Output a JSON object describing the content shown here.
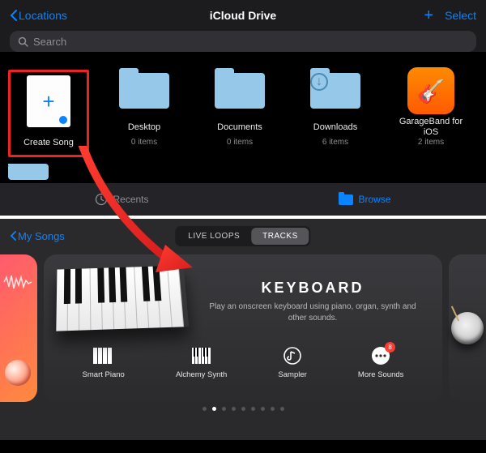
{
  "top": {
    "back_label": "Locations",
    "title": "iCloud Drive",
    "select_label": "Select",
    "search_placeholder": "Search",
    "items": [
      {
        "label": "Create Song",
        "sub": ""
      },
      {
        "label": "Desktop",
        "sub": "0 items",
        "glyph": ""
      },
      {
        "label": "Documents",
        "sub": "0 items",
        "glyph": ""
      },
      {
        "label": "Downloads",
        "sub": "6 items",
        "glyph": "↓"
      },
      {
        "label": "GarageBand for\niOS",
        "sub": "2 items"
      }
    ],
    "tabs": {
      "recents": "Recents",
      "browse": "Browse"
    }
  },
  "gb": {
    "back_label": "My Songs",
    "segments": {
      "loops": "LIVE LOOPS",
      "tracks": "TRACKS"
    },
    "keyboard": {
      "title": "KEYBOARD",
      "desc": "Play an onscreen keyboard using piano, organ, synth and other sounds."
    },
    "options": [
      {
        "label": "Smart Piano"
      },
      {
        "label": "Alchemy Synth"
      },
      {
        "label": "Sampler"
      },
      {
        "label": "More Sounds",
        "badge": "8"
      }
    ]
  }
}
